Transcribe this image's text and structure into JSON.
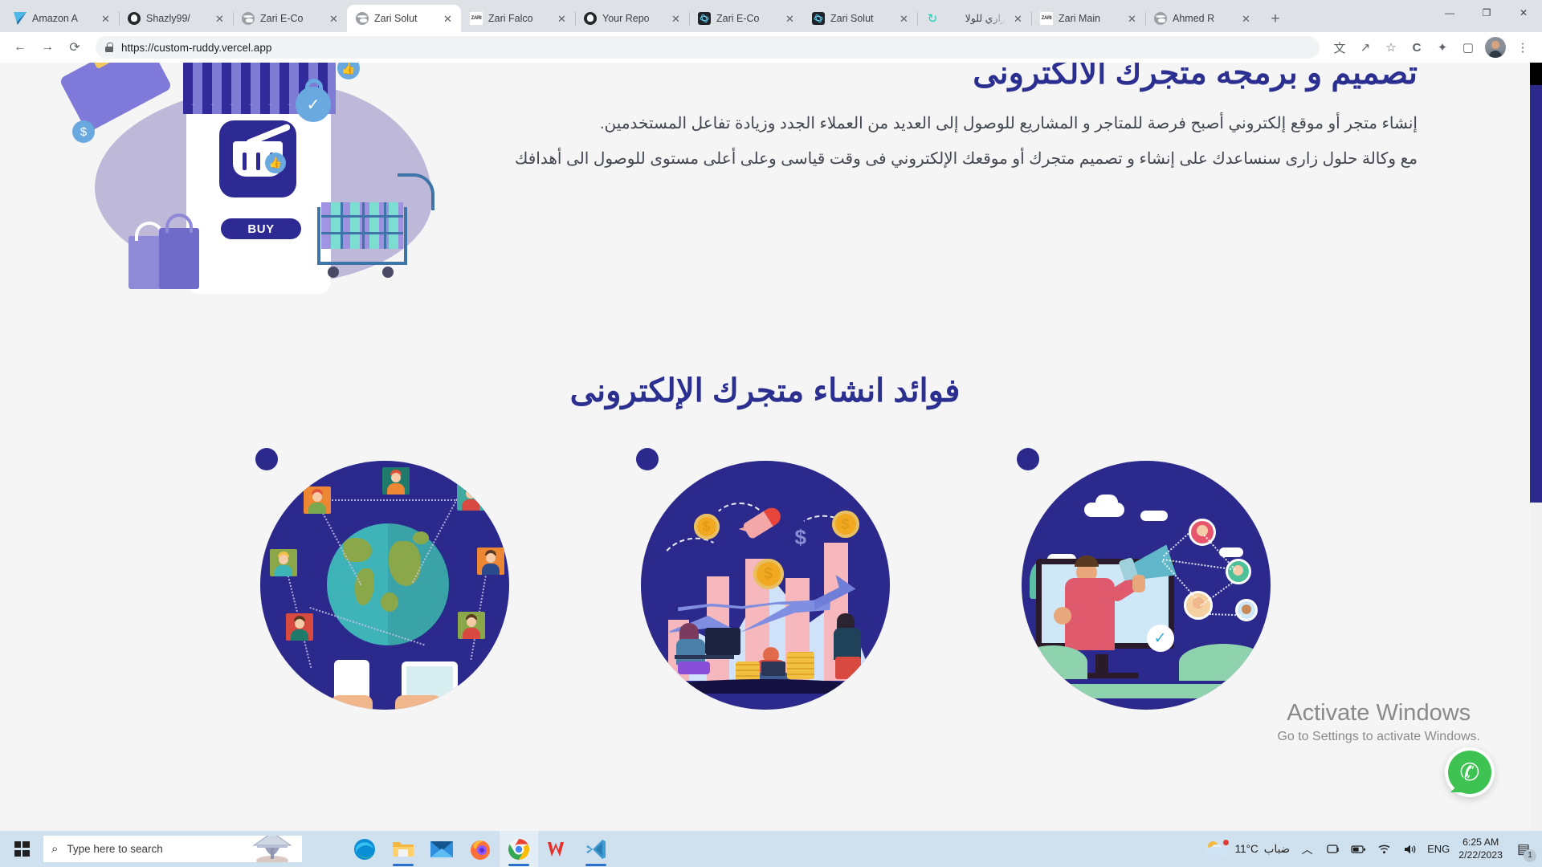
{
  "browser": {
    "tabs": [
      {
        "title": "Amazon A",
        "favicon": "amazon-icon",
        "active": false
      },
      {
        "title": "Shazly99/",
        "favicon": "github-icon",
        "active": false
      },
      {
        "title": "Zari E-Co",
        "favicon": "globe-icon",
        "active": false
      },
      {
        "title": "Zari Solut",
        "favicon": "globe-icon",
        "active": true
      },
      {
        "title": "Zari Falco",
        "favicon": "zari-icon",
        "active": false
      },
      {
        "title": "Your Repo",
        "favicon": "github-icon",
        "active": false
      },
      {
        "title": "Zari E-Co",
        "favicon": "react-icon",
        "active": false
      },
      {
        "title": "Zari Solut",
        "favicon": "react-icon",
        "active": false
      },
      {
        "title": "زاري للولا",
        "favicon": "refresh-icon",
        "active": false
      },
      {
        "title": "Zari Main",
        "favicon": "zari-icon",
        "active": false
      },
      {
        "title": "Ahmed R",
        "favicon": "globe-icon",
        "active": false
      }
    ],
    "new_tab_label": "+",
    "window_controls": {
      "minimize": "—",
      "restore": "❐",
      "close": "✕"
    },
    "toolbar": {
      "back": "←",
      "forward": "→",
      "reload": "⟳",
      "url": "https://custom-ruddy.vercel.app",
      "lock_icon": "lock-icon",
      "icons": [
        "translate-icon",
        "share-icon",
        "bookmark-star-icon",
        "c-badge-icon",
        "extensions-icon",
        "sidebar-icon"
      ],
      "translate_glyph": "文",
      "share_glyph": "↗",
      "star_glyph": "☆",
      "c_glyph": "C",
      "puzzle_glyph": "✦",
      "sidebar_glyph": "▢",
      "menu_glyph": "⋮"
    },
    "close_glyph": "✕"
  },
  "page": {
    "hero": {
      "title": "تصميم و برمجه متجرك الالكترونى",
      "paragraph_1": "إنشاء متجر أو موقع إلكتروني أصبح فرصة للمتاجر و المشاريع للوصول إلى العديد من العملاء الجدد وزيادة تفاعل المستخدمين.",
      "paragraph_2": "مع وكالة حلول زارى سنساعدك على إنشاء و تصميم متجرك أو موقعك الإلكتروني فى وقت قياسى وعلى أعلى مستوى للوصول الى أهدافك",
      "illustration_name": "ecommerce-storefront-illustration",
      "buy_button_label": "BUY"
    },
    "benefits": {
      "title": "فوائد انشاء متجرك الإلكترونى",
      "cards": [
        {
          "illustration_name": "global-network-illustration"
        },
        {
          "illustration_name": "business-growth-illustration"
        },
        {
          "illustration_name": "digital-marketing-illustration"
        }
      ]
    },
    "whatsapp_label": "whatsapp-chat-button",
    "whatsapp_glyph": "✆"
  },
  "watermark": {
    "line1": "Activate Windows",
    "line2": "Go to Settings to activate Windows."
  },
  "taskbar": {
    "search_placeholder": "Type here to search",
    "search_icon": "search-icon",
    "start_icon": "windows-start-icon",
    "apps": [
      {
        "name": "microsoft-edge",
        "active": false,
        "running": false
      },
      {
        "name": "file-explorer",
        "active": false,
        "running": true
      },
      {
        "name": "mail",
        "active": false,
        "running": false
      },
      {
        "name": "firefox",
        "active": false,
        "running": false
      },
      {
        "name": "google-chrome",
        "active": true,
        "running": true
      },
      {
        "name": "wps-office",
        "active": false,
        "running": false
      },
      {
        "name": "visual-studio-code",
        "active": false,
        "running": true
      }
    ],
    "tray": {
      "weather_temp": "11°C",
      "weather_desc": "ضباب",
      "chevron": "︿",
      "icons": [
        "screen-cast-icon",
        "battery-icon",
        "wifi-icon",
        "volume-icon"
      ],
      "language": "ENG",
      "time": "6:25 AM",
      "date": "2/22/2023",
      "notification_count": "1",
      "notification_icon": "notifications-icon"
    }
  },
  "colors": {
    "brand_navy": "#2b2a8c",
    "heading": "#2b2f8f",
    "body_text": "#41464f",
    "page_bg": "#f5f5f5",
    "taskbar": "#cfe0ee",
    "whatsapp_green": "#3ec252"
  }
}
